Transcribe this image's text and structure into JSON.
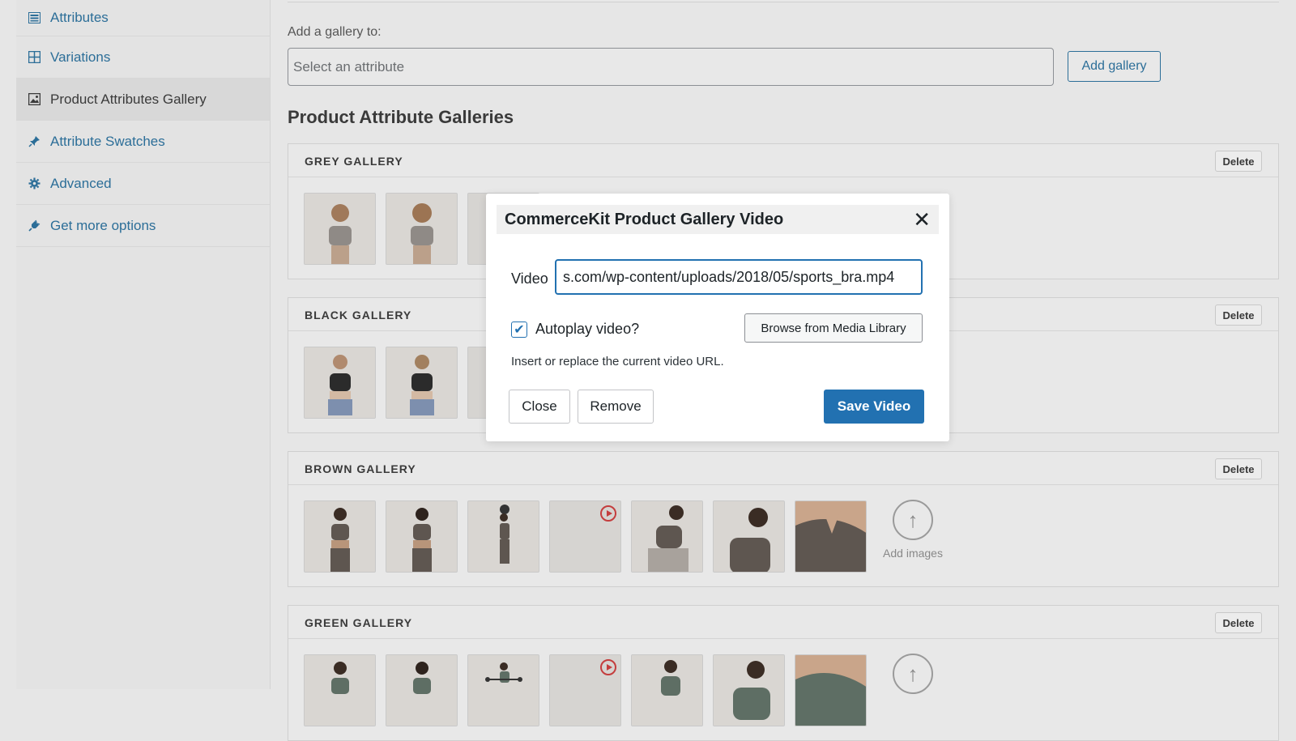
{
  "sidebar": {
    "items": [
      {
        "label": "Attributes",
        "icon": "list-icon"
      },
      {
        "label": "Variations",
        "icon": "grid-icon"
      },
      {
        "label": "Product Attributes Gallery",
        "icon": "image-icon"
      },
      {
        "label": "Attribute Swatches",
        "icon": "pin-icon"
      },
      {
        "label": "Advanced",
        "icon": "gear-icon"
      },
      {
        "label": "Get more options",
        "icon": "plugin-icon"
      }
    ]
  },
  "main": {
    "add_label": "Add a gallery to:",
    "select_placeholder": "Select an attribute",
    "add_gallery_button": "Add gallery",
    "section_title": "Product Attribute Galleries",
    "delete_label": "Delete",
    "add_images_label": "Add images",
    "galleries": [
      {
        "title": "GREY GALLERY"
      },
      {
        "title": "BLACK GALLERY"
      },
      {
        "title": "BROWN GALLERY"
      },
      {
        "title": "GREEN GALLERY"
      }
    ]
  },
  "modal": {
    "title": "CommerceKit Product Gallery Video",
    "video_label": "Video",
    "video_value": "s.com/wp-content/uploads/2018/05/sports_bra.mp4",
    "autoplay_label": "Autoplay video?",
    "autoplay_checked": true,
    "browse_button": "Browse from Media Library",
    "help_text": "Insert or replace the current video URL.",
    "close_button": "Close",
    "remove_button": "Remove",
    "save_button": "Save Video"
  },
  "colors": {
    "accent": "#2271b1",
    "link": "#2c6e98",
    "play_icon": "#c43d3d",
    "background": "#e6e6e6"
  }
}
